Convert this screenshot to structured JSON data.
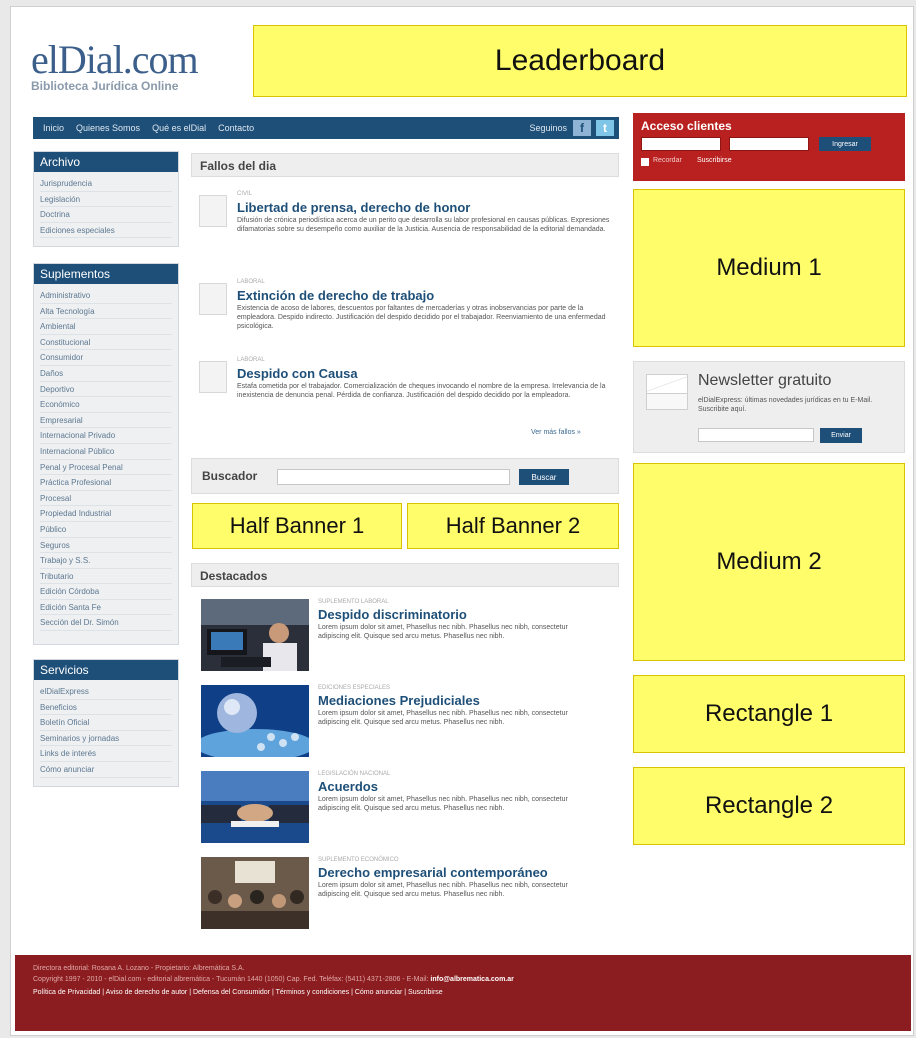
{
  "brand": {
    "logo_text": "elDial.com",
    "tagline": "Biblioteca Jurídica Online"
  },
  "ads": {
    "leaderboard": "Leaderboard",
    "medium1": "Medium 1",
    "medium2": "Medium 2",
    "half1": "Half Banner 1",
    "half2": "Half Banner 2",
    "rect1": "Rectangle 1",
    "rect2": "Rectangle 2"
  },
  "nav": {
    "items": [
      "Inicio",
      "Quienes Somos",
      "Qué es elDial",
      "Contacto"
    ],
    "follow_label": "Seguinos",
    "facebook_glyph": "f",
    "twitter_glyph": "t"
  },
  "sidebar": {
    "archivo": {
      "title": "Archivo",
      "items": [
        "Jurisprudencia",
        "Legislación",
        "Doctrina",
        "Ediciones especiales"
      ]
    },
    "suplementos": {
      "title": "Suplementos",
      "items": [
        "Administrativo",
        "Alta Tecnología",
        "Ambiental",
        "Constitucional",
        "Consumidor",
        "Daños",
        "Deportivo",
        "Económico",
        "Empresarial",
        "Internacional Privado",
        "Internacional Público",
        "Penal y Procesal Penal",
        "Práctica Profesional",
        "Procesal",
        "Propiedad Industrial",
        "Público",
        "Seguros",
        "Trabajo y S.S.",
        "Tributario",
        "Edición Córdoba",
        "Edición Santa Fe",
        "Sección del Dr. Simón"
      ]
    },
    "servicios": {
      "title": "Servicios",
      "items": [
        "elDialExpress",
        "Beneficios",
        "Boletín Oficial",
        "Seminarios y jornadas",
        "Links de interés",
        "Cómo anunciar"
      ]
    }
  },
  "fallos": {
    "title": "Fallos del dia",
    "items": [
      {
        "category": "CIVIL",
        "title": "Libertad de prensa, derecho de honor",
        "text": "Difusión de crónica periodística acerca de un perito que desarrolla su labor profesional en causas públicas. Expresiones difamatorias sobre su desempeño como auxiliar de la Justicia. Ausencia de responsabilidad de la editorial demandada."
      },
      {
        "category": "LABORAL",
        "title": "Extinción de derecho de trabajo",
        "text": "Existencia de acoso de labores, descuentos por faltantes de mercaderías y otras inobservancias por parte de la empleadora. Despido indirecto. Justificación del despido decidido por el trabajador. Reenviamiento de una enfermedad psicológica."
      },
      {
        "category": "LABORAL",
        "title": "Despido con Causa",
        "text": "Estafa cometida por el trabajador. Comercialización de cheques invocando el nombre de la empresa. Irrelevancia de la inexistencia de denuncia penal. Pérdida de confianza. Justificación del despido decidido por la empleadora."
      }
    ],
    "more_label": "Ver más fallos »"
  },
  "buscador": {
    "label": "Buscador",
    "button": "Buscar",
    "value": ""
  },
  "destacados": {
    "title": "Destacados",
    "items": [
      {
        "category": "SUPLEMENTO LABORAL",
        "title": "Despido discriminatorio",
        "text": "Lorem ipsum dolor sit amet, Phasellus nec nibh. Phasellus nec nibh, consectetur adipiscing elit. Quisque sed arcu metus. Phasellus nec nibh."
      },
      {
        "category": "EDICIONES ESPECIALES",
        "title": "Mediaciones Prejudiciales",
        "text": "Lorem ipsum dolor sit amet, Phasellus nec nibh. Phasellus nec nibh, consectetur adipiscing elit. Quisque sed arcu metus. Phasellus nec nibh."
      },
      {
        "category": "LEGISLACIÓN NACIONAL",
        "title": "Acuerdos",
        "text": "Lorem ipsum dolor sit amet, Phasellus nec nibh. Phasellus nec nibh, consectetur adipiscing elit. Quisque sed arcu metus. Phasellus nec nibh."
      },
      {
        "category": "SUPLEMENTO ECONÓMICO",
        "title": "Derecho empresarial contemporáneo",
        "text": "Lorem ipsum dolor sit amet, Phasellus nec nibh. Phasellus nec nibh, consectetur adipiscing elit. Quisque sed arcu metus. Phasellus nec nibh."
      }
    ]
  },
  "acceso": {
    "title": "Acceso clientes",
    "button": "Ingresar",
    "remember": "Recordar",
    "subscribe": "Suscribirse",
    "user_value": "",
    "pass_value": ""
  },
  "newsletter": {
    "title": "Newsletter gratuito",
    "text": "elDialExpress: últimas novedades jurídicas en tu E-Mail. Suscribite aquí.",
    "button": "Enviar",
    "value": ""
  },
  "footer": {
    "line1": "Directora editorial: Rosana A. Lozano - Propietario: Albremática S.A.",
    "line2": "Copyright 1997 - 2010 - elDial.com - editorial albremática - Tucumán 1440 (1050) Cap. Fed. Teléfax: (5411) 4371-2806 - E-Mail:",
    "email": "info@albrematica.com.ar",
    "links": [
      "Política de Privacidad",
      "Aviso de derecho de autor",
      "Defensa del Consumidor",
      "Términos y condiciones",
      "Cómo anunciar",
      "Suscribirse"
    ]
  },
  "colors": {
    "primary": "#1e4f78",
    "accent_red": "#b8211f",
    "footer": "#8b1c1f",
    "ad_yellow": "#fffd6a"
  }
}
